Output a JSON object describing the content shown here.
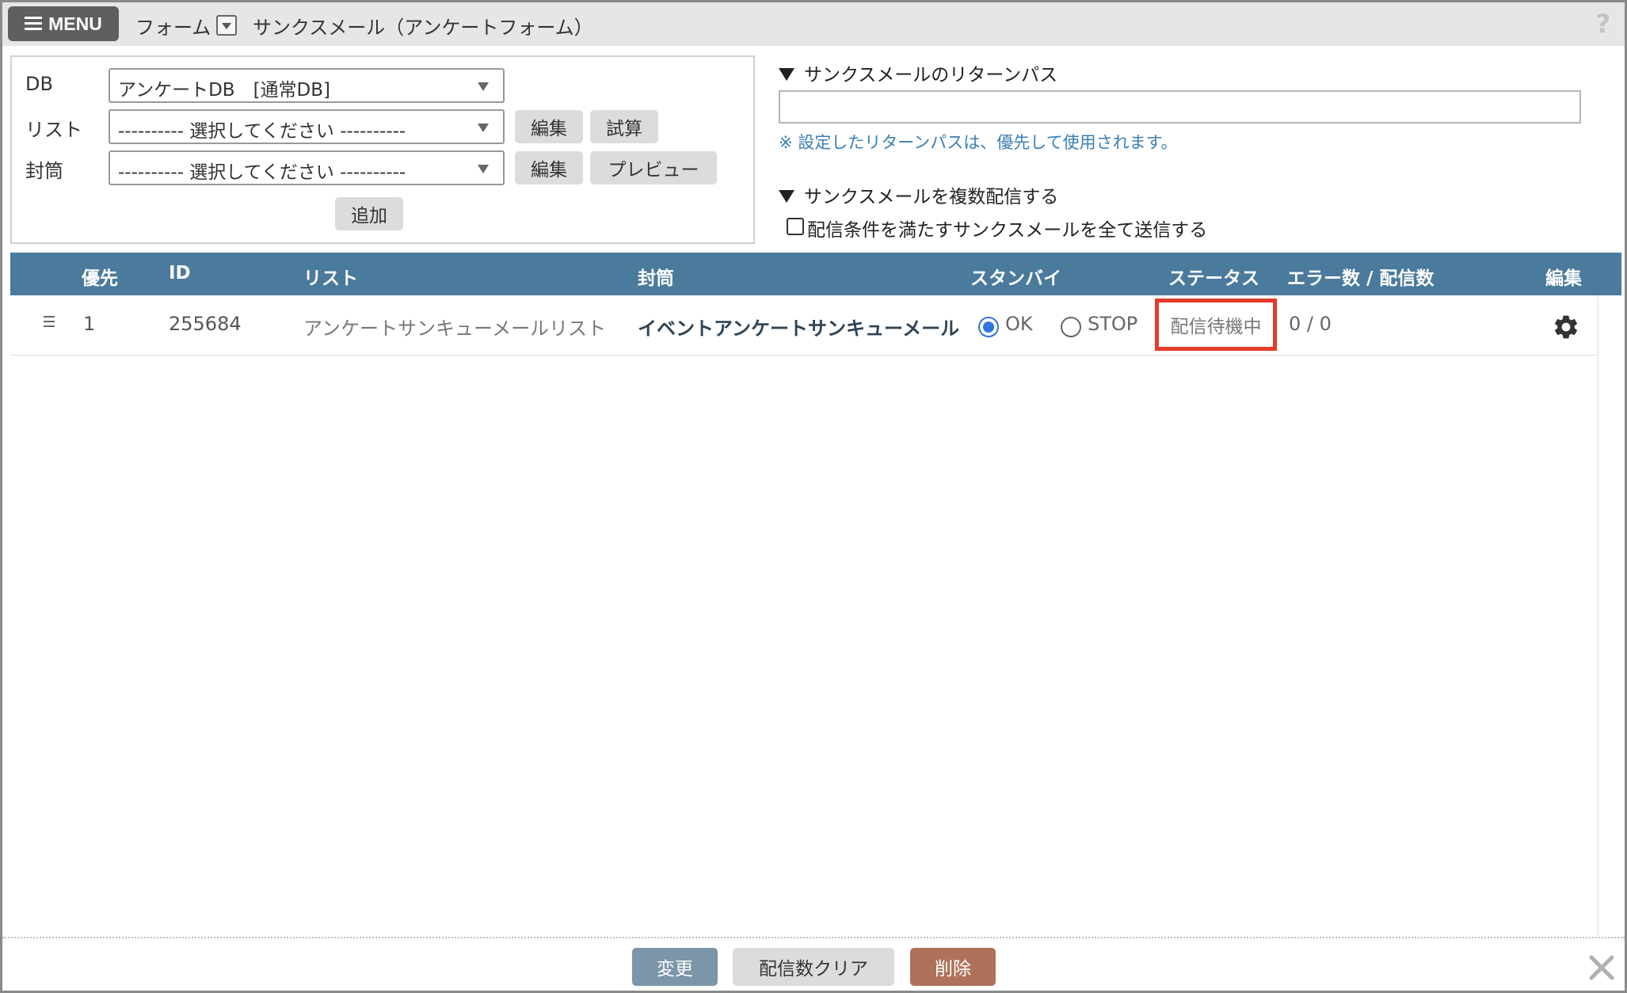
{
  "header": {
    "menu_label": "MENU",
    "breadcrumb": "フォーム",
    "page_title": "サンクスメール（アンケートフォーム）",
    "help": "?"
  },
  "form": {
    "db_label": "DB",
    "db_value": "アンケートDB　[通常DB]",
    "list_label": "リスト",
    "list_value": "---------- 選択してください ----------",
    "envelope_label": "封筒",
    "envelope_value": "---------- 選択してください ----------",
    "edit_label": "編集",
    "trial_label": "試算",
    "preview_label": "プレビュー",
    "add_label": "追加"
  },
  "return_path": {
    "title": "サンクスメールのリターンパス",
    "value": "",
    "note": "※ 設定したリターンパスは、優先して使用されます。"
  },
  "multi_send": {
    "title": "サンクスメールを複数配信する",
    "checkbox_label": "配信条件を満たすサンクスメールを全て送信する",
    "checked": false
  },
  "table": {
    "headers": {
      "priority": "優先",
      "id": "ID",
      "list": "リスト",
      "envelope": "封筒",
      "standby": "スタンバイ",
      "status": "ステータス",
      "counts": "エラー数 / 配信数",
      "edit": "編集"
    },
    "rows": [
      {
        "priority": "1",
        "id": "255684",
        "list": "アンケートサンキューメールリスト",
        "envelope": "イベントアンケートサンキューメール",
        "standby_ok": "OK",
        "standby_stop": "STOP",
        "standby_selected": "OK",
        "status": "配信待機中",
        "counts": "0 / 0"
      }
    ]
  },
  "footer": {
    "change_label": "変更",
    "clear_label": "配信数クリア",
    "delete_label": "削除"
  },
  "colors": {
    "table_header": "#4a7a9c",
    "highlight": "#e53c2a",
    "change_button": "#7a96a8",
    "delete_button": "#b0715a",
    "note_text": "#3a7fb5"
  }
}
